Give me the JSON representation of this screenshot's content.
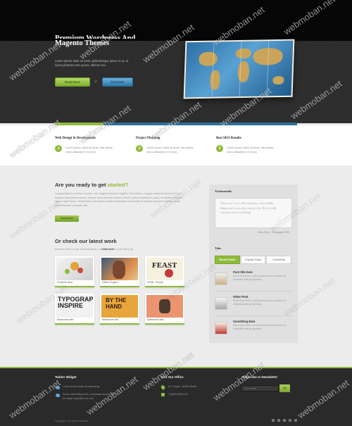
{
  "hero": {
    "title_line1": "Premium Wordpress And",
    "title_line2": "Magento Themes",
    "text": "Lorem ipsum dolor sit amet, pellentesque ipsum et ut, ut luctus pharetra sem purus, ultrices nec.",
    "button_primary": "Read More",
    "or": "or",
    "button_secondary": "Purchase"
  },
  "stripe_colors": [
    "#8fbb3b",
    "#2d6f9c",
    "#2d6f9c",
    "#2d6f9c",
    "#2d6f9c"
  ],
  "features": [
    {
      "title": "Web Design & Development",
      "num": "1",
      "text": "Lorem ipsum dolor sit amet, ists habes choro absulas in ei sumo."
    },
    {
      "title": "Project Planning",
      "num": "2",
      "text": "Lorem ipsum dolor sit amet, ists habes choro absulas in ei sumo."
    },
    {
      "title": "Best SEO Results",
      "num": "3",
      "text": "Lorem ipsum dolor sit amet, ists habes choro absulas in ei sumo."
    }
  ],
  "ready": {
    "title_a": "Are you ready to get ",
    "title_b": "started?",
    "text": "Suspendisse in pretium mauris, nec magna tincidunt sagittis. Duis tellus, congue euismod laoreet luctus magna. Maecenas cursus, tempor risus pharetra auctor, lorem metus vestibulum justo, sit eleifend magna augue eget libero. Vestibulum ante ipsum primis in faucibus orci luctus et ultrices posuere cubilia Curae; Morbi facilisis molestie nisi.",
    "button": "Read More"
  },
  "work": {
    "title": "Or check our latest work",
    "sub_a": "Browse some of our latest projects, or ",
    "sub_b": "click here",
    "sub_c": " to see them all.",
    "items": [
      {
        "caption": "Portfolio item"
      },
      {
        "caption": "Other Project"
      },
      {
        "caption": "HTML Theme"
      },
      {
        "caption": "Awesome site"
      },
      {
        "caption": "Awesome site"
      },
      {
        "caption": "Awesome site"
      }
    ]
  },
  "sidebar": {
    "testimonials_title": "Testimonials",
    "quote": "What can I say? This company is incredible. Happened to me after trying a lot. We're really satisfied with everything!",
    "quote_author": "John Doe - Company CEO",
    "tabs_title": "Tabs",
    "tabs": [
      "Recent Posts",
      "Popular Posts",
      "Comments"
    ],
    "posts": [
      {
        "title": "Post title here",
        "text": "Some text here. Lorem ipsum dolor sit amet un molestim ante ga gravida..."
      },
      {
        "title": "Other Post",
        "text": "Some text here. Lorem ipsum dolor sit amet un molestim ante ga gravida..."
      },
      {
        "title": "Something Else",
        "text": "Some text here. Lorem ipsum dolor sit amet un molestim ante ga gravida..."
      }
    ]
  },
  "footer": {
    "twitter_title": "Twitter Widget",
    "tweet1": "Lorem ipsum dolor sit #themesp",
    "tweet2_a": "Some other thing here or because tweets can",
    "tweet2_b": "be really long after the rest",
    "office_title": "Visit Our Office",
    "address": "St. Tropez, 16300 Monte",
    "phone": "+1(000)-0000-00",
    "newsletter_title": "Subscribe to Newsletter",
    "newsletter_placeholder": "Your email",
    "newsletter_button": "Go",
    "copyright": "Copyright © all rights reserved."
  },
  "watermark": "webmoban.net"
}
